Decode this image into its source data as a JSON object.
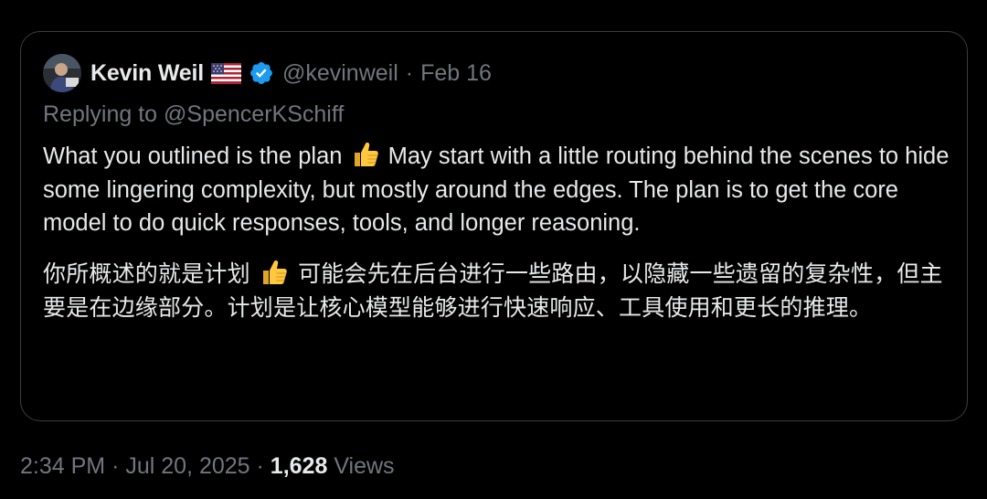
{
  "quoted_post": {
    "author": {
      "display_name": "Kevin Weil",
      "flag_emoji": "us-flag-icon",
      "verified_badge": "verified-checkmark-icon",
      "handle": "@kevinweil",
      "separator": "·",
      "date": "Feb 16"
    },
    "replying_to_prefix": "Replying to ",
    "replying_to_handle": "@SpencerKSchiff",
    "paragraph_en": {
      "before_emoji": "What you outlined is the plan ",
      "emoji": "thumbs-up-icon",
      "after_emoji": " May start with a little routing behind the scenes to hide some lingering complexity, but mostly around the edges. The plan is to get the core model to do quick responses, tools, and longer reasoning."
    },
    "paragraph_zh": {
      "before_emoji": "你所概述的就是计划 ",
      "emoji": "thumbs-up-icon",
      "after_emoji": " 可能会先在后台进行一些路由，以隐藏一些遗留的复杂性，但主要是在边缘部分。计划是让核心模型能够进行快速响应、工具使用和更长的推理。"
    }
  },
  "post_meta": {
    "time": "2:34 PM",
    "separator": "·",
    "date": "Jul 20, 2025",
    "views_count": "1,628",
    "views_label": "Views"
  },
  "colors": {
    "background": "#000000",
    "primary_text": "#e7e9ea",
    "secondary_text": "#71767b",
    "card_border": "#3a3d41",
    "verified_blue": "#1d9bf0",
    "thumbs_yellow": "#ffc83d"
  }
}
